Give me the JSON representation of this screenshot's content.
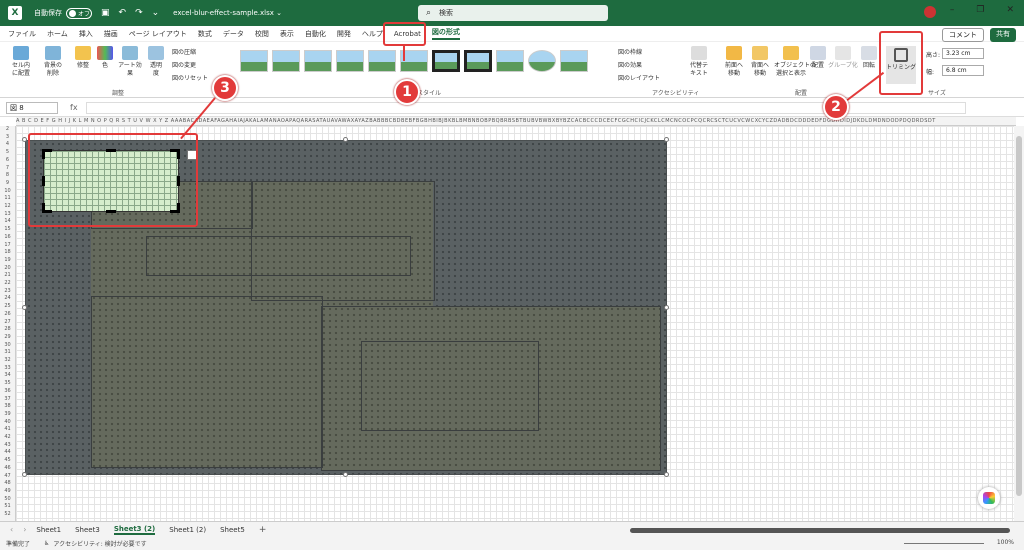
{
  "titlebar": {
    "autosave_label": "自動保存",
    "autosave_state": "オフ",
    "filename": "excel-blur-effect-sample.xlsx ⌄",
    "search_placeholder": "検索"
  },
  "menu": {
    "tabs": [
      "ファイル",
      "ホーム",
      "挿入",
      "描画",
      "ページ レイアウト",
      "数式",
      "データ",
      "校閲",
      "表示",
      "自動化",
      "開発",
      "ヘルプ",
      "Acrobat",
      "図の形式"
    ],
    "comment": "コメント",
    "share": "共有"
  },
  "ribbon": {
    "btn_cell_place": "セル内\nに配置",
    "btn_remove_bg": "背景の\n削除",
    "btn_corrections": "修整",
    "btn_color": "色",
    "btn_artistic": "アート効果",
    "btn_transparency": "透明\n度",
    "compress": "図の圧縮",
    "change": "図の変更",
    "reset": "図のリセット",
    "group_adjust": "調整",
    "group_styles": "図のスタイル",
    "border": "図の枠線",
    "effects": "図の効果",
    "layout": "図のレイアウト",
    "alt_text": "代替テ\nキスト",
    "group_accessibility": "アクセシビリティ",
    "bring_forward": "前面へ\n移動",
    "send_backward": "背面へ\n移動",
    "selection_pane": "オブジェクトの\n選択と表示",
    "align": "配置",
    "group_btn": "グループ化",
    "rotate": "回転",
    "group_arrange": "配置",
    "crop": "トリミング",
    "height_label": "高さ:",
    "height_value": "3.23 cm",
    "width_label": "幅:",
    "width_value": "6.8 cm",
    "group_size": "サイズ"
  },
  "formula": {
    "namebox": "図 8",
    "fx": "fx"
  },
  "columns": "A B C D E F G H I J K L M N O P Q R S T U V W X Y Z AAABACADAEAFAGAHAIAJAKALAMANAOAPAQARASATAUAVAWAXAYAZBABBBCBDBEBFBGBHBIBJBKBLBMBNBOBPBQBRBSBTBUBVBWBXBYBZCACBCCCDCECFCGCHCICJCKCLCMCNCOCPCQCRCSCTCUCVCWCXCYCZDADBDCDDDEDFDGDHDIDJDKDLDMDNDODPDQDRDSDT",
  "rows": [
    "2",
    "3",
    "4",
    "5",
    "6",
    "7",
    "8",
    "9",
    "10",
    "11",
    "12",
    "13",
    "14",
    "15",
    "16",
    "17",
    "18",
    "19",
    "20",
    "21",
    "22",
    "23",
    "24",
    "25",
    "26",
    "27",
    "28",
    "29",
    "30",
    "31",
    "32",
    "33",
    "34",
    "35",
    "36",
    "37",
    "38",
    "39",
    "40",
    "41",
    "42",
    "43",
    "44",
    "45",
    "46",
    "47",
    "48",
    "49",
    "50",
    "51",
    "52"
  ],
  "annotations": [
    "1",
    "2",
    "3"
  ],
  "sheets": [
    "Sheet1",
    "Sheet3",
    "Sheet3 (2)",
    "Sheet1 (2)",
    "Sheet5"
  ],
  "active_sheet": "Sheet3 (2)",
  "status": {
    "ready": "準備完了",
    "accessibility": "アクセシビリティ: 検討が必要です",
    "zoom": "100%"
  }
}
